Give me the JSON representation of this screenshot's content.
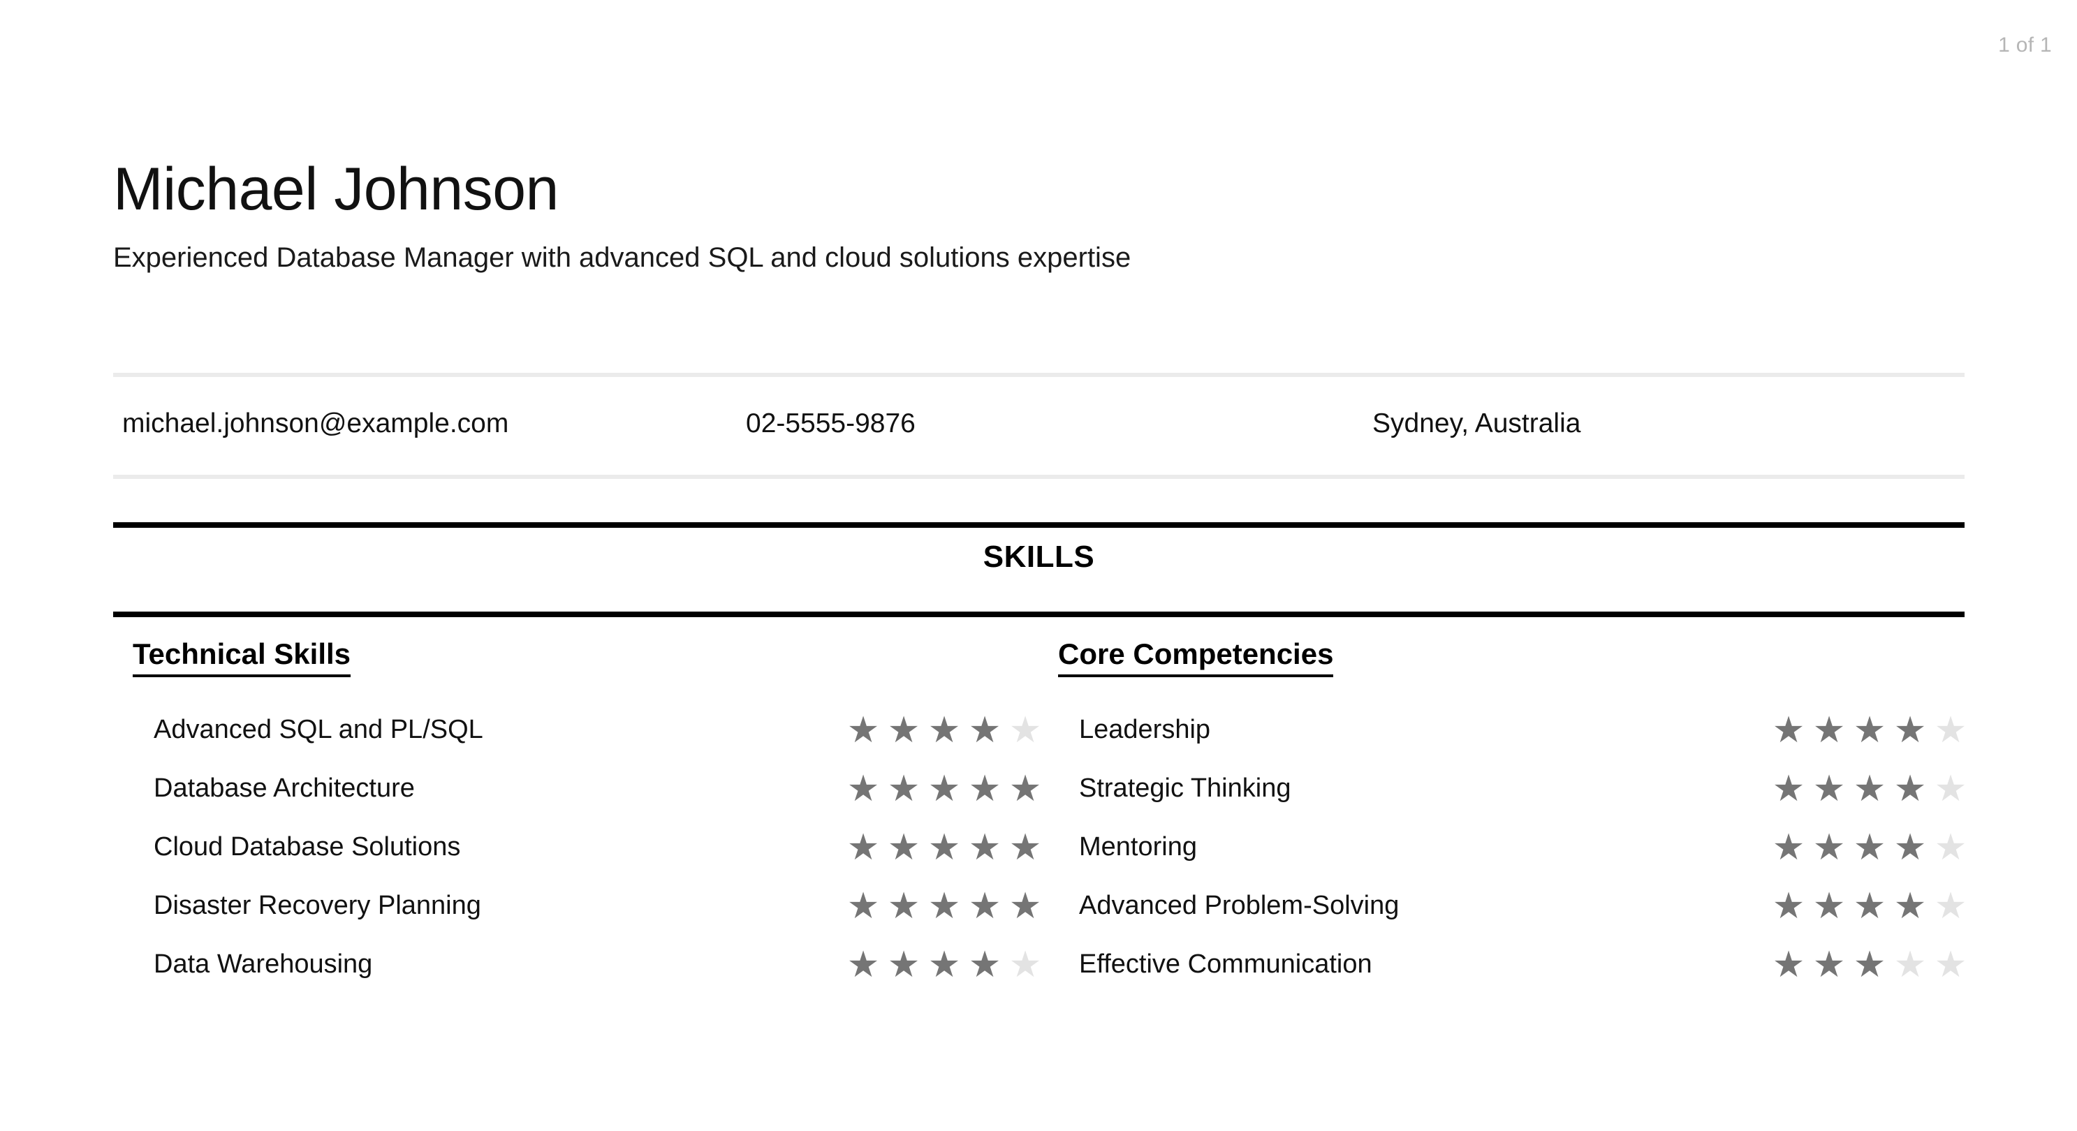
{
  "viewer": {
    "page_indicator": "1 of 1"
  },
  "header": {
    "full_name": "Michael Johnson",
    "headline": "Experienced Database Manager with advanced SQL and cloud solutions expertise"
  },
  "contact": {
    "email": "michael.johnson@example.com",
    "phone": "02-5555-9876",
    "location": "Sydney, Australia"
  },
  "skills_section": {
    "title": "SKILLS",
    "columns": [
      {
        "heading": "Technical Skills",
        "items": [
          {
            "label": "Advanced SQL and PL/SQL",
            "rating": 4,
            "max": 5
          },
          {
            "label": "Database Architecture",
            "rating": 5,
            "max": 5
          },
          {
            "label": "Cloud Database Solutions",
            "rating": 5,
            "max": 5
          },
          {
            "label": "Disaster Recovery Planning",
            "rating": 5,
            "max": 5
          },
          {
            "label": "Data Warehousing",
            "rating": 4,
            "max": 5
          }
        ]
      },
      {
        "heading": "Core Competencies",
        "items": [
          {
            "label": "Leadership",
            "rating": 4,
            "max": 5
          },
          {
            "label": "Strategic Thinking",
            "rating": 4,
            "max": 5
          },
          {
            "label": "Mentoring",
            "rating": 4,
            "max": 5
          },
          {
            "label": "Advanced Problem-Solving",
            "rating": 4,
            "max": 5
          },
          {
            "label": "Effective Communication",
            "rating": 3,
            "max": 5
          }
        ]
      }
    ],
    "star_glyph": "★",
    "star_filled_color": "#757575",
    "star_empty_color": "#e3e3e3"
  },
  "theme": {
    "background": "#ffffff",
    "text": "#111111",
    "rule_light": "#ebebeb",
    "rule_dark": "#000000",
    "muted": "#b5b5b5"
  }
}
